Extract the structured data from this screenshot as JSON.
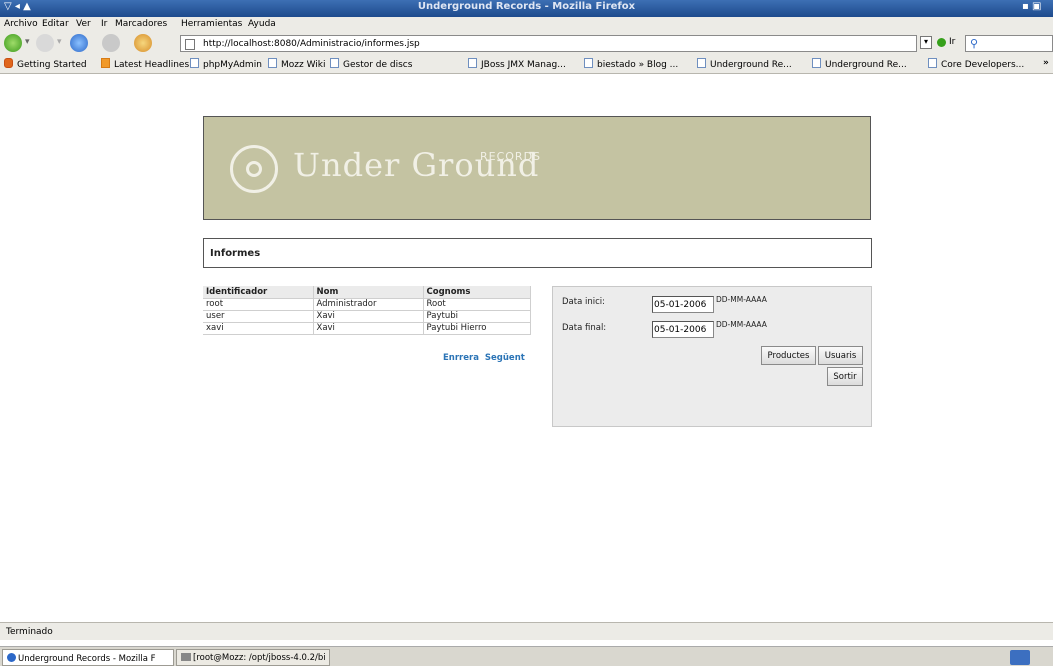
{
  "window": {
    "title": "Underground Records - Mozilla Firefox"
  },
  "menubar": {
    "items": [
      "Archivo",
      "Editar",
      "Ver",
      "Ir",
      "Marcadores",
      "Herramientas",
      "Ayuda"
    ]
  },
  "navbar": {
    "url": "http://localhost:8080/Administracio/informes.jsp",
    "go_label": "Ir"
  },
  "bookmarks": [
    "Getting Started",
    "Latest Headlines",
    "phpMyAdmin",
    "Mozz Wiki",
    "Gestor de discs",
    "JBoss JMX Manag...",
    "biestado » Blog ...",
    "Underground Re...",
    "Underground Re...",
    "Core Developers..."
  ],
  "banner": {
    "logo_main": "Under Ground",
    "logo_sub": "RECORDS"
  },
  "page": {
    "section_title": "Informes"
  },
  "user_table": {
    "headers": [
      "Identificador",
      "Nom",
      "Cognoms"
    ],
    "rows": [
      [
        "root",
        "Administrador",
        "Root"
      ],
      [
        "user",
        "Xavi",
        "Paytubi"
      ],
      [
        "xavi",
        "Xavi",
        "Paytubi Hierro"
      ]
    ],
    "prev_label": "Enrrera",
    "next_label": "Següent"
  },
  "report_form": {
    "start_label": "Data inici:",
    "start_value": "05-01-2006",
    "end_label": "Data final:",
    "end_value": "05-01-2006",
    "date_hint": "DD-MM-AAAA",
    "productes_label": "Productes",
    "usuaris_label": "Usuaris",
    "sortir_label": "Sortir"
  },
  "statusbar": {
    "text": "Terminado"
  },
  "taskbar": {
    "items": [
      "Underground Records - Mozilla F",
      "[root@Mozz: /opt/jboss-4.0.2/bi"
    ]
  },
  "colors": {
    "banner_bg": "#c4c3a2",
    "link": "#2b74b6",
    "titlebar": "#2a5ca0"
  }
}
